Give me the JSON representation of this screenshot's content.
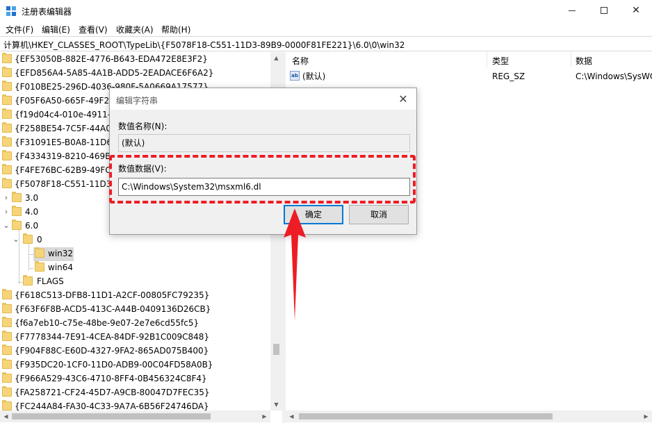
{
  "window": {
    "title": "注册表编辑器"
  },
  "menu": [
    "文件(F)",
    "编辑(E)",
    "查看(V)",
    "收藏夹(A)",
    "帮助(H)"
  ],
  "address": "计算机\\HKEY_CLASSES_ROOT\\TypeLib\\{F5078F18-C551-11D3-89B9-0000F81FE221}\\6.0\\0\\win32",
  "tree": {
    "top_items": [
      "{EF53050B-882E-4776-B643-EDA472E8E3F2}",
      "{EFD856A4-5A85-4A1B-ADD5-2EADACE6F6A2}",
      "{F010BE25-296D-4036-980F-5A0669A17577}",
      "{F05F6A50-665F-49F2-A",
      "{f19d04c4-010e-4911-a",
      "{F258BE54-7C5F-44A0-A",
      "{F31091E5-B0A8-11D6-B",
      "{F4334319-8210-469B-8",
      "{F4FE76BC-62B9-49FC-9",
      "{F5078F18-C551-11D3-8"
    ],
    "version_items": [
      "3.0",
      "4.0",
      "6.0"
    ],
    "lang_item": "0",
    "platform_items": [
      "win32",
      "win64"
    ],
    "flags_item": "FLAGS",
    "bottom_items": [
      "{F618C513-DFB8-11D1-A2CF-00805FC79235}",
      "{F63F6F8B-ACD5-413C-A44B-0409136D26CB}",
      "{f6a7eb10-c75e-48be-9e07-2e7e6cd55fc5}",
      "{F7778344-7E91-4CEA-84DF-92B1C009C848}",
      "{F904F88C-E60D-4327-9FA2-865AD075B400}",
      "{F935DC20-1CF0-11D0-ADB9-00C04FD58A0B}",
      "{F966A529-43C6-4710-8FF4-0B456324C8F4}",
      "{FA258721-CF24-45D7-A9CB-80047D7FEC35}",
      "{FC244A84-FA30-4C33-9A7A-6B56F24746DA}"
    ]
  },
  "values_pane": {
    "headers": {
      "name": "名称",
      "type": "类型",
      "data": "数据"
    },
    "rows": [
      {
        "icon": "ab-string-icon",
        "name": "(默认)",
        "type": "REG_SZ",
        "data": "C:\\Windows\\SysWO"
      }
    ]
  },
  "dialog": {
    "title": "编辑字符串",
    "name_label": "数值名称(N):",
    "name_value": "(默认)",
    "data_label": "数值数据(V):",
    "data_value": "C:\\Windows\\System32\\msxml6.dl",
    "ok_label": "确定",
    "cancel_label": "取消"
  },
  "annotation": {
    "color": "#ee1c24"
  }
}
